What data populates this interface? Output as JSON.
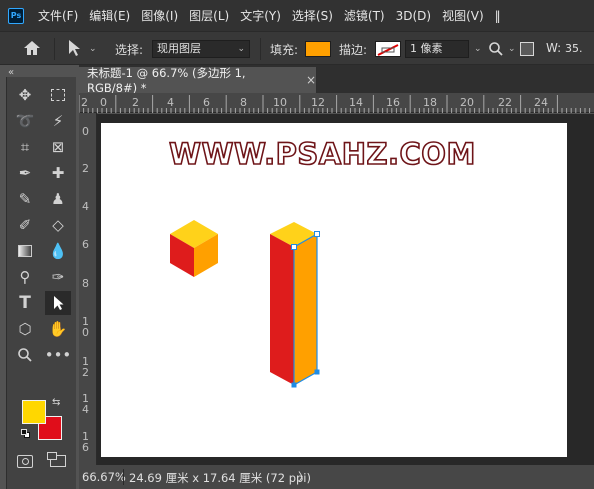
{
  "app": {
    "logo": "Ps"
  },
  "menu": [
    "文件(F)",
    "编辑(E)",
    "图像(I)",
    "图层(L)",
    "文字(Y)",
    "选择(S)",
    "滤镜(T)",
    "3D(D)",
    "视图(V)"
  ],
  "options": {
    "select_label": "选择:",
    "select_value": "现用图层",
    "fill_label": "填充:",
    "fill_color": "#ffa000",
    "stroke_label": "描边:",
    "stroke_width": "1 像素",
    "w_label": "W:",
    "w_value": "35."
  },
  "document": {
    "tab_title": "未标题-1 @ 66.7% (多边形 1, RGB/8#) *",
    "close_symbol": "×"
  },
  "ruler": {
    "h_labels": [
      "2",
      "0",
      "2",
      "4",
      "6",
      "8",
      "10",
      "12",
      "14",
      "16",
      "18",
      "20",
      "22",
      "24"
    ],
    "v_labels": [
      "0",
      "2",
      "4",
      "6",
      "8",
      "1\n0",
      "1\n2",
      "1\n4",
      "1\n6"
    ]
  },
  "canvas": {
    "watermark": "WWW.PSAHZ.COM",
    "colors": {
      "top": "#ffd21a",
      "left": "#de1c1c",
      "right": "#ffa000",
      "anchor": "#1e8ce6"
    }
  },
  "swatches": {
    "foreground": "#ffd700",
    "background": "#e00d1a"
  },
  "status": {
    "zoom": "66.67%",
    "doc_size": "24.69 厘米 x 17.64 厘米 (72 ppi)",
    "arrow": "〉"
  },
  "icons": [
    "home-icon",
    "move-arrow-icon",
    "search-icon",
    "marquee-icon",
    "lasso-icon",
    "magic-wand-icon",
    "crop-icon",
    "frame-icon",
    "eyedropper-icon",
    "healing-icon",
    "brush-icon",
    "stamp-icon",
    "history-brush-icon",
    "eraser-icon",
    "gradient-icon",
    "blur-icon",
    "dodge-icon",
    "pen-icon",
    "type-icon",
    "path-select-icon",
    "shape-icon",
    "hand-icon",
    "zoom-icon",
    "more-icon",
    "quick-mask-icon",
    "screen-mode-icon"
  ]
}
